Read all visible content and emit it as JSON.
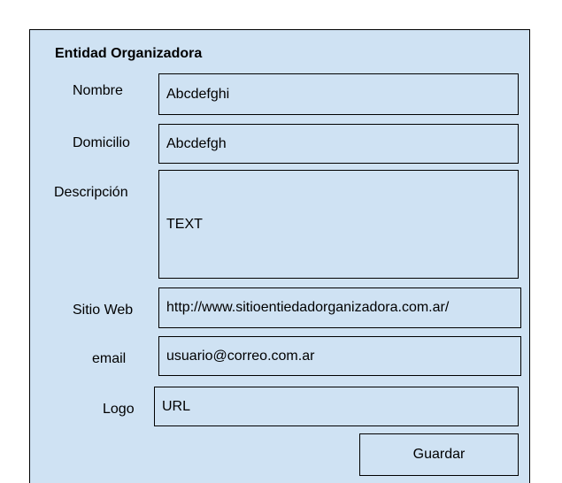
{
  "form": {
    "title": "Entidad Organizadora",
    "fields": {
      "nombre": {
        "label": "Nombre",
        "value": "Abcdefghi"
      },
      "domicilio": {
        "label": "Domicilio",
        "value": "Abcdefgh"
      },
      "descripcion": {
        "label": "Descripción",
        "value": "TEXT"
      },
      "sitio_web": {
        "label": "Sitio Web",
        "value": "http://www.sitioentiedadorganizadora.com.ar/"
      },
      "email": {
        "label": "email",
        "value": "usuario@correo.com.ar"
      },
      "logo": {
        "label": "Logo",
        "value": "URL"
      }
    },
    "save_label": "Guardar"
  },
  "colors": {
    "panel_background": "#cfe2f3",
    "border": "#000000"
  }
}
